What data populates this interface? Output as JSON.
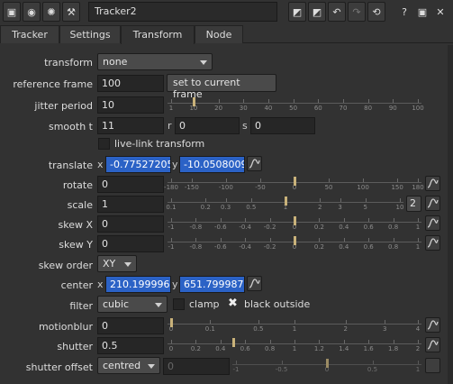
{
  "toolbar": {
    "node_name": "Tracker2",
    "help": "?"
  },
  "tabs": [
    {
      "label": "Tracker"
    },
    {
      "label": "Settings"
    },
    {
      "label": "Transform"
    },
    {
      "label": "Node"
    }
  ],
  "transform": {
    "label": "transform",
    "value": "none"
  },
  "reference_frame": {
    "label": "reference frame",
    "value": "100",
    "button": "set to current frame"
  },
  "jitter_period": {
    "label": "jitter period",
    "value": "10",
    "ticks": [
      "1",
      "10",
      "20",
      "30",
      "40",
      "50",
      "60",
      "70",
      "80",
      "90",
      "100"
    ],
    "handle": 10
  },
  "smooth": {
    "label": "smooth t",
    "t": "11",
    "r_label": "r",
    "r": "0",
    "s_label": "s",
    "s": "0"
  },
  "live_link": {
    "label": "live-link transform"
  },
  "translate": {
    "label": "translate",
    "x_label": "x",
    "x": "-0.77527205",
    "y_label": "y",
    "y": "-10.0508009"
  },
  "rotate": {
    "label": "rotate",
    "value": "0",
    "ticks": [
      "-180",
      "-150",
      "-100",
      "-50",
      "0",
      "50",
      "100",
      "150",
      "180"
    ],
    "handle": 0
  },
  "scale": {
    "label": "scale",
    "value": "1",
    "ticks": [
      "0.1",
      "0.2",
      "0.3",
      "0.5",
      "1",
      "2",
      "3",
      "5",
      "10"
    ],
    "handle": 1,
    "badge": "2"
  },
  "skew_x": {
    "label": "skew X",
    "value": "0",
    "ticks": [
      "-1",
      "-0.8",
      "-0.6",
      "-0.4",
      "-0.2",
      "0",
      "0.2",
      "0.4",
      "0.6",
      "0.8",
      "1"
    ],
    "handle": 0
  },
  "skew_y": {
    "label": "skew Y",
    "value": "0",
    "ticks": [
      "-1",
      "-0.8",
      "-0.6",
      "-0.4",
      "-0.2",
      "0",
      "0.2",
      "0.4",
      "0.6",
      "0.8",
      "1"
    ],
    "handle": 0
  },
  "skew_order": {
    "label": "skew order",
    "value": "XY"
  },
  "center": {
    "label": "center",
    "x_label": "x",
    "x": "210.1999969",
    "y_label": "y",
    "y": "651.7999877"
  },
  "filter": {
    "label": "filter",
    "value": "cubic",
    "clamp": "clamp",
    "black_outside": "black outside",
    "black_outside_mark": "✖"
  },
  "motionblur": {
    "label": "motionblur",
    "value": "0",
    "ticks": [
      "0",
      "0.1",
      "0.5",
      "1",
      "2",
      "3",
      "4"
    ],
    "handle": 0
  },
  "shutter": {
    "label": "shutter",
    "value": "0.5",
    "ticks": [
      "0",
      "0.2",
      "0.4",
      "0.6",
      "0.8",
      "1",
      "1.2",
      "1.4",
      "1.6",
      "1.8",
      "2"
    ],
    "handle": 0.5
  },
  "shutter_offset": {
    "label": "shutter offset",
    "value": "centred",
    "custom": "0",
    "ticks": [
      "-1",
      "-0.5",
      "0",
      "0.5",
      "1"
    ],
    "handle": 0
  },
  "colors": {
    "accent": "#2b62c6",
    "handle": "#c9b27a"
  }
}
